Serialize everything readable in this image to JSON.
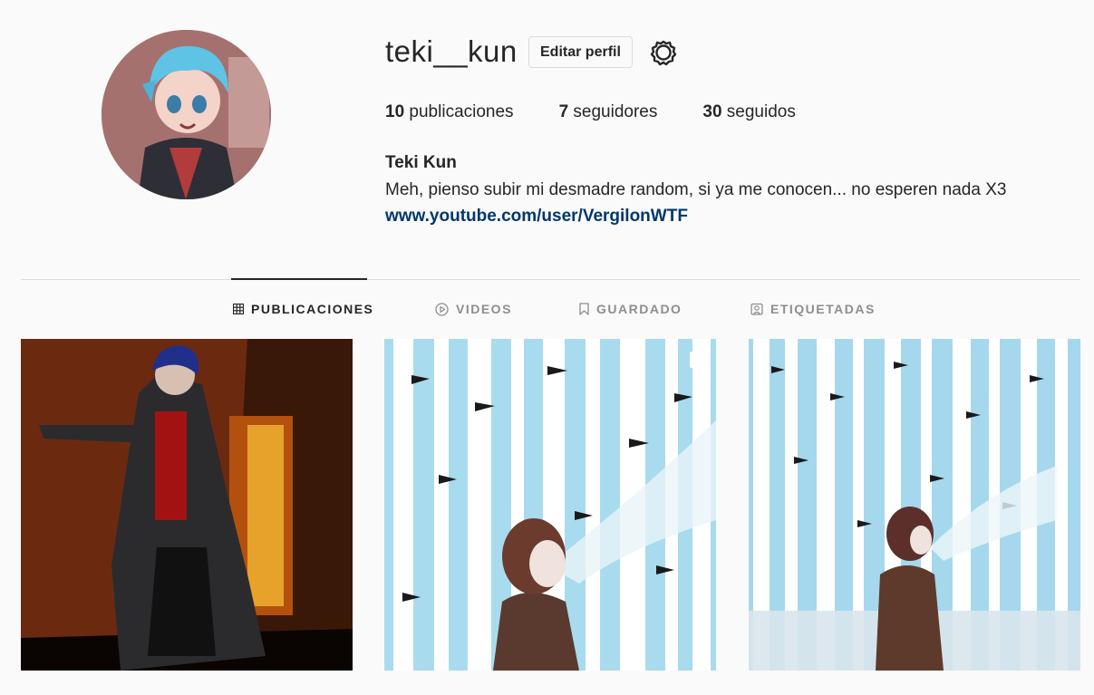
{
  "profile": {
    "username": "teki__kun",
    "edit_label": "Editar perfil",
    "settings_icon": "gear-icon",
    "stats": {
      "posts_count": "10",
      "posts_label": " publicaciones",
      "followers_count": "7",
      "followers_label": " seguidores",
      "following_count": "30",
      "following_label": " seguidos"
    },
    "full_name": "Teki Kun",
    "bio": "Meh, pienso subir mi desmadre random, si ya me conocen... no esperen nada X3",
    "link": "www.youtube.com/user/VergilonWTF"
  },
  "tabs": [
    {
      "label": "PUBLICACIONES",
      "icon": "grid-icon",
      "active": true
    },
    {
      "label": "VIDEOS",
      "icon": "play-circle-icon",
      "active": false
    },
    {
      "label": "GUARDADO",
      "icon": "bookmark-icon",
      "active": false
    },
    {
      "label": "ETIQUETADAS",
      "icon": "tagged-user-icon",
      "active": false
    }
  ],
  "posts": [
    {
      "subject": "figure-in-dark-coat"
    },
    {
      "subject": "woman-in-snowy-birch-forest",
      "badge": "multi-post-icon"
    },
    {
      "subject": "figure-in-snowstorm-forest"
    }
  ],
  "colors": {
    "text": "#262626",
    "muted": "#8e8e8e",
    "link": "#00376b",
    "border": "#dbdbdb",
    "background": "#fafafa"
  }
}
